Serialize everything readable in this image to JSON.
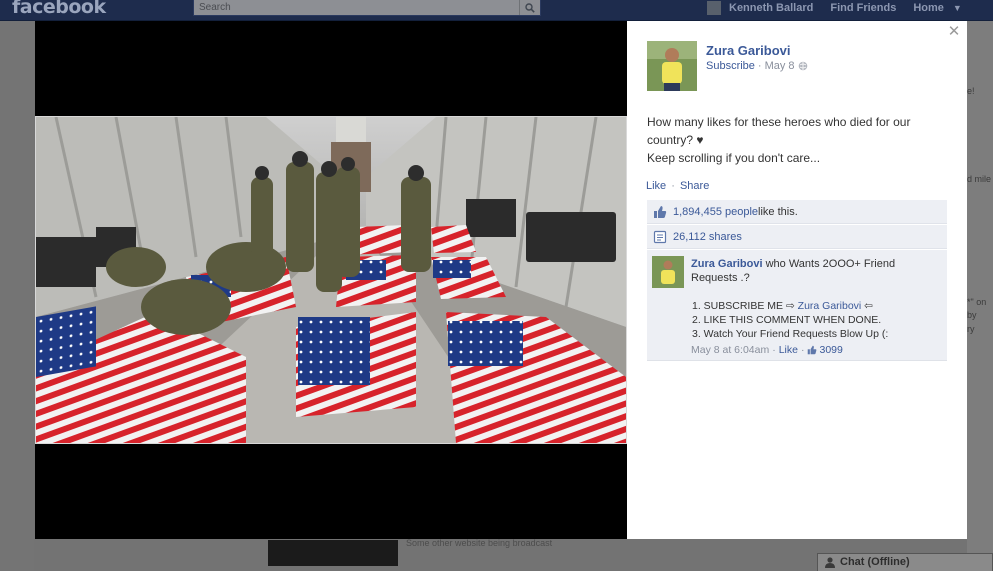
{
  "topbar": {
    "logo": "facebook",
    "search_placeholder": "Search",
    "user_name": "Kenneth Ballard",
    "find_friends": "Find Friends",
    "home": "Home"
  },
  "background": {
    "fragment_1": "e!",
    "fragment_2": "d mile",
    "fragment_3": "*\" on",
    "fragment_4": "by",
    "fragment_5": "ry",
    "footer_snippet": "Some other website being broadcast"
  },
  "chat": {
    "label": "Chat (Offline)"
  },
  "post": {
    "author": "Zura Garibovi",
    "subscribe": "Subscribe",
    "date": "May 8",
    "caption_line1": "How many likes for these heroes who died for our country? ♥",
    "caption_line2": "Keep scrolling if you don't care...",
    "like": "Like",
    "share": "Share",
    "likes_count": "1,894,455 people",
    "likes_suffix": " like this.",
    "shares": "26,112 shares"
  },
  "comment": {
    "author": "Zura Garibovi",
    "text": " who Wants 2OOO+ Friend Requests .?",
    "line1_prefix": "1. SUBSCRIBE ME ⇨ ",
    "line1_link": "Zura Garibovi",
    "line1_suffix": " ⇦",
    "line2": "2. LIKE THIS COMMENT WHEN DONE.",
    "line3": "3. Watch Your Friend Requests Blow Up (:",
    "time": "May 8 at 6:04am",
    "like": "Like",
    "like_count": "3099"
  },
  "icons": {
    "close": "close-icon",
    "globe": "globe-icon",
    "thumbs_up": "thumbs-up-icon",
    "share": "share-icon",
    "search": "search-icon",
    "chat": "chat-icon"
  },
  "colors": {
    "link": "#3b5998",
    "ufi_bg": "#edeff4",
    "topbar": "#1e2c4d"
  }
}
